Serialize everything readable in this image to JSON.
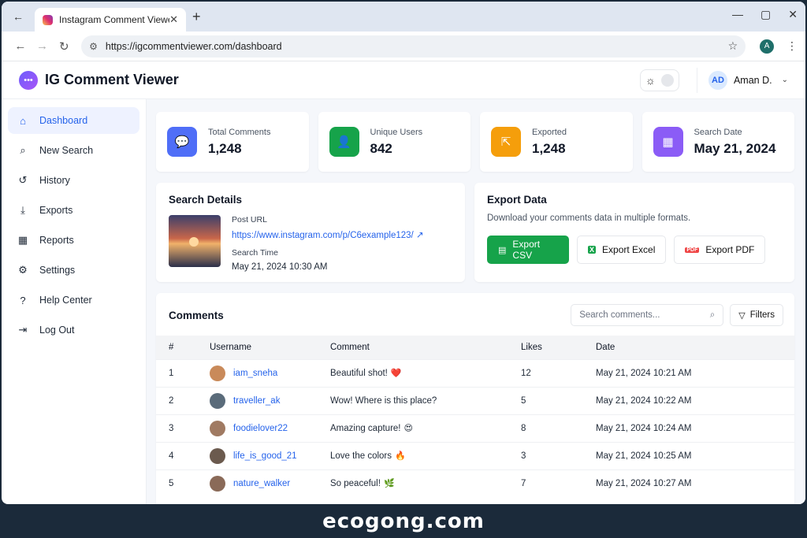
{
  "browser": {
    "tab_title": "Instagram Comment Viewer",
    "url": "https://igcommentviewer.com/dashboard",
    "profile_initial": "A"
  },
  "app": {
    "title": "IG Comment Viewer",
    "user_initials": "AD",
    "user_name": "Aman D."
  },
  "sidebar": {
    "items": [
      {
        "label": "Dashboard",
        "icon": "home-icon",
        "active": true
      },
      {
        "label": "New Search",
        "icon": "search-icon"
      },
      {
        "label": "History",
        "icon": "history-icon"
      },
      {
        "label": "Exports",
        "icon": "download-icon"
      },
      {
        "label": "Reports",
        "icon": "reports-icon"
      },
      {
        "label": "Settings",
        "icon": "gear-icon"
      },
      {
        "label": "Help Center",
        "icon": "help-icon"
      },
      {
        "label": "Log Out",
        "icon": "logout-icon"
      }
    ]
  },
  "stats": [
    {
      "label": "Total Comments",
      "value": "1,248",
      "color": "#4f6ef7",
      "icon": "chat-icon"
    },
    {
      "label": "Unique Users",
      "value": "842",
      "color": "#16a34a",
      "icon": "user-icon"
    },
    {
      "label": "Exported",
      "value": "1,248",
      "color": "#f59e0b",
      "icon": "export-icon"
    },
    {
      "label": "Search Date",
      "value": "May 21, 2024",
      "color": "#8b5cf6",
      "icon": "calendar-icon"
    }
  ],
  "search_details": {
    "title": "Search Details",
    "post_url_label": "Post URL",
    "post_url": "https://www.instagram.com/p/C6example123/",
    "search_time_label": "Search Time",
    "search_time": "May 21, 2024 10:30 AM"
  },
  "export": {
    "title": "Export Data",
    "subtitle": "Download your comments data in multiple formats.",
    "csv_label": "Export CSV",
    "excel_label": "Export Excel",
    "pdf_label": "Export PDF"
  },
  "comments": {
    "title": "Comments",
    "search_placeholder": "Search comments...",
    "filters_label": "Filters",
    "columns": [
      "#",
      "Username",
      "Comment",
      "Likes",
      "Date"
    ],
    "rows": [
      {
        "num": "1",
        "username": "iam_sneha",
        "comment": "Beautiful shot!",
        "emoji": "❤️",
        "likes": "12",
        "date": "May 21, 2024 10:21 AM",
        "avatar_color": "#c98a5a"
      },
      {
        "num": "2",
        "username": "traveller_ak",
        "comment": "Wow! Where is this place?",
        "emoji": "",
        "likes": "5",
        "date": "May 21, 2024 10:22 AM",
        "avatar_color": "#5a6b7a"
      },
      {
        "num": "3",
        "username": "foodielover22",
        "comment": "Amazing capture!",
        "emoji": "😍",
        "likes": "8",
        "date": "May 21, 2024 10:24 AM",
        "avatar_color": "#a07a62"
      },
      {
        "num": "4",
        "username": "life_is_good_21",
        "comment": "Love the colors",
        "emoji": "🔥",
        "likes": "3",
        "date": "May 21, 2024 10:25 AM",
        "avatar_color": "#6b5a4e"
      },
      {
        "num": "5",
        "username": "nature_walker",
        "comment": "So peaceful!",
        "emoji": "🌿",
        "likes": "7",
        "date": "May 21, 2024 10:27 AM",
        "avatar_color": "#8a6a58"
      }
    ]
  },
  "footer": {
    "watermark": "ecogong.com"
  }
}
